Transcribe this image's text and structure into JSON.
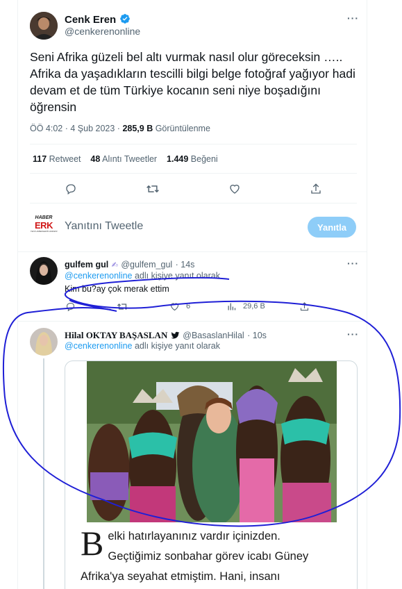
{
  "main_tweet": {
    "author_name": "Cenk Eren",
    "author_handle": "@cenkerenonline",
    "text": "Seni Afrika güzeli bel altı vurmak nasıl olur göreceksin ….. Afrika da yaşadıkların tescilli bilgi belge fotoğraf yağıyor hadi devam et de tüm Türkiye kocanın seni niye boşadığını öğrensin",
    "time": "ÖÖ 4:02 · 4 Şub 2023 ·",
    "views_count": "285,9 B",
    "views_label": "Görüntülenme",
    "retweets_count": "117",
    "retweets_label": "Retweet",
    "quotes_count": "48",
    "quotes_label": "Alıntı Tweetler",
    "likes_count": "1.449",
    "likes_label": "Beğeni"
  },
  "reply_box": {
    "logo_text": "HABER",
    "logo_big": "ERK",
    "logo_tagline": "YENİ HABERLERİN ADRESİ",
    "placeholder": "Yanıtını Tweetle",
    "button_label": "Yanıtla"
  },
  "reply1": {
    "name": "gulfem gul",
    "handle": "@gulfem_gul",
    "time": "· 14s",
    "replying_to_handle": "@cenkerenonline",
    "replying_to_suffix": "adlı kişiye yanıt olarak",
    "text": "Kim bu?ay çok merak ettim",
    "likes_count": "6",
    "views_count": "29,6 B"
  },
  "reply2": {
    "name": "Hilal OKTAY BAŞASLAN",
    "handle": "@BasaslanHilal",
    "time": "· 10s",
    "replying_to_handle": "@cenkerenonline",
    "replying_to_suffix": "adlı kişiye yanıt olarak",
    "article_dropcap": "B",
    "article_line1": "elki hatırlayanınız vardır içinizden.",
    "article_line2": "Geçtiğimiz sonbahar görev icabı Güney",
    "article_line3": "Afrika'ya seyahat etmiştim. Hani, insanı"
  },
  "colors": {
    "accent": "#1d9bf0",
    "reply_button": "#8ecdf8",
    "annotation_ink": "#1f1fd6"
  },
  "icons": [
    "verified-icon",
    "more-icon",
    "reply-icon",
    "retweet-icon",
    "like-icon",
    "share-icon",
    "views-icon",
    "bird-icon"
  ]
}
